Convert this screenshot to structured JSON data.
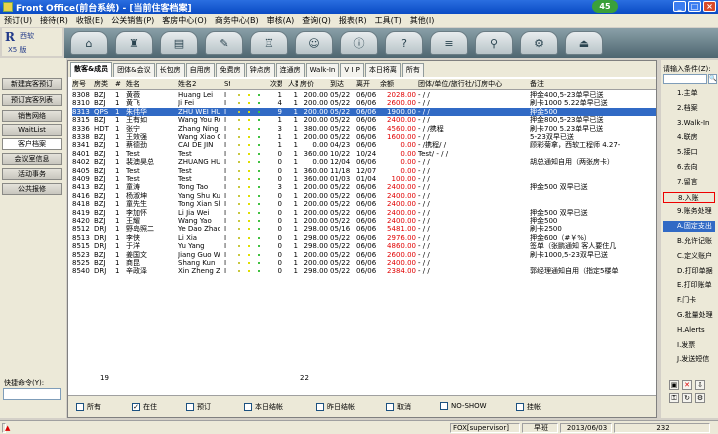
{
  "window": {
    "title": "Front Office(前台系统) - [当前住客档案]",
    "notification_count": "45"
  },
  "menu": [
    "预订(U)",
    "接待(R)",
    "收银(E)",
    "公关销售(P)",
    "客房中心(O)",
    "商务中心(B)",
    "审核(A)",
    "查询(Q)",
    "报表(R)",
    "工具(T)",
    "其他(I)"
  ],
  "logo": {
    "mark": "R",
    "brand": "西软",
    "version": "X5 版"
  },
  "left_nav": [
    "新建宾客预订",
    "预订宾客列表",
    "销售网络",
    "WaitList",
    "客户档案",
    "会议室信息",
    "活动事务",
    "公共报修"
  ],
  "shortcut_label": "快捷命令(Y):",
  "tabs": [
    "散客&成员",
    "团体&会议",
    "长包房",
    "自用房",
    "免费房",
    "钟点房",
    "连通房",
    "Walk-In",
    "V I P",
    "本日将离",
    "所有"
  ],
  "table": {
    "headers": [
      "房号",
      "房类",
      "#",
      "姓名",
      "姓名2",
      "Sta",
      "",
      "次数",
      "人数",
      "房价",
      "到达",
      "离开",
      "余额",
      "团体/单位/旅行社/订房中心",
      "备注"
    ],
    "rows": [
      [
        "8308",
        "BZJ",
        "1",
        "黄薇",
        "Huang Lei",
        "I",
        "1",
        "1",
        "200.00",
        "05/22",
        "06/06",
        "2028.00",
        "- / /",
        "押金400,5-23单早已送"
      ],
      [
        "8310",
        "BZJ",
        "1",
        "黄飞",
        "Ji Fei",
        "I",
        "4",
        "1",
        "200.00",
        "05/22",
        "06/06",
        "2600.00",
        "- / /",
        "刷卡1000  5.22单早已送"
      ],
      [
        "8313",
        "QPS",
        "1",
        "朱伟华",
        "ZHU WEI HUA",
        "I",
        "9",
        "1",
        "200.00",
        "05/22",
        "06/06",
        "1900.00",
        "- / /",
        "押金500"
      ],
      [
        "8315",
        "BZJ",
        "1",
        "王有如",
        "Wang You Ru",
        "I",
        "1",
        "1",
        "200.00",
        "05/22",
        "06/06",
        "2400.00",
        "- / /",
        "押金800,5-23单早已送"
      ],
      [
        "8336",
        "HDT",
        "1",
        "张宁",
        "Zhang Ning",
        "I",
        "3",
        "1",
        "380.00",
        "05/22",
        "06/06",
        "4560.00",
        "- / /携程",
        "刷卡700  5.23单早已送"
      ],
      [
        "8338",
        "BZJ",
        "1",
        "王效强",
        "Wang Xiao Q",
        "I",
        "1",
        "1",
        "200.00",
        "05/22",
        "06/06",
        "1600.00",
        "- / /",
        "5-23双早已送"
      ],
      [
        "8341",
        "BZJ",
        "1",
        "蔡德劲",
        "CAI DE JIN",
        "I",
        "1",
        "1",
        "0.00",
        "04/23",
        "06/06",
        "0.00",
        "- /携程/ /",
        "顾彩菊拿，西软工程师 4.27-"
      ],
      [
        "8401",
        "BZJ",
        "1",
        "Test",
        "Test",
        "I",
        "0",
        "1",
        "360.00",
        "10/22",
        "10/24",
        "0.00",
        "Test/ - / /",
        ""
      ],
      [
        "8402",
        "BZJ",
        "1",
        "裴澳昊总",
        "ZHUANG HUAN",
        "I",
        "0",
        "1",
        "0.00",
        "12/04",
        "06/06",
        "0.00",
        "- / /",
        "胡总通知自用（两张房卡）"
      ],
      [
        "8405",
        "BZJ",
        "1",
        "Test",
        "Test",
        "I",
        "0",
        "1",
        "360.00",
        "11/18",
        "12/07",
        "0.00",
        "- / /",
        ""
      ],
      [
        "8409",
        "BZJ",
        "1",
        "Test",
        "Test",
        "I",
        "0",
        "1",
        "360.00",
        "01/03",
        "01/04",
        "100.00",
        "- / /",
        ""
      ],
      [
        "8413",
        "BZJ",
        "1",
        "童涛",
        "Tong Tao",
        "I",
        "3",
        "1",
        "200.00",
        "05/22",
        "06/06",
        "2400.00",
        "- / /",
        "押金500 双早已送"
      ],
      [
        "8416",
        "BZJ",
        "1",
        "杨淑坤",
        "Yang Shu Kun",
        "I",
        "0",
        "1",
        "200.00",
        "05/22",
        "06/06",
        "2400.00",
        "- / /",
        ""
      ],
      [
        "8418",
        "BZJ",
        "1",
        "童先生",
        "Tong Xian Sh",
        "I",
        "0",
        "1",
        "200.00",
        "05/22",
        "06/06",
        "2400.00",
        "- / /",
        ""
      ],
      [
        "8419",
        "BZJ",
        "1",
        "李加怀",
        "Li Jia Wei",
        "I",
        "0",
        "1",
        "200.00",
        "05/22",
        "06/06",
        "2400.00",
        "- / /",
        "押金500  双早已送"
      ],
      [
        "8420",
        "BZJ",
        "1",
        "王耀",
        "Wang Yao",
        "I",
        "0",
        "1",
        "200.00",
        "05/22",
        "06/06",
        "2400.00",
        "- / /",
        "押金500"
      ],
      [
        "8512",
        "DRJ",
        "1",
        "野岛照二",
        "Ye Dao Zhao E",
        "I",
        "0",
        "1",
        "298.00",
        "05/16",
        "06/06",
        "5481.00",
        "- / /",
        "刷卡2500"
      ],
      [
        "8513",
        "DRJ",
        "1",
        "李侠",
        "Li Xia",
        "I",
        "0",
        "1",
        "298.00",
        "05/22",
        "06/06",
        "2976.00",
        "- / /",
        "押金600（#￥%）"
      ],
      [
        "8515",
        "DRJ",
        "1",
        "于洋",
        "Yu Yang",
        "I",
        "0",
        "1",
        "298.00",
        "05/22",
        "06/06",
        "4860.00",
        "- / /",
        "签单（张鹏通知 客人要住几"
      ],
      [
        "8523",
        "BZJ",
        "1",
        "姜国文",
        "Jiang Guo Wen",
        "I",
        "0",
        "1",
        "200.00",
        "05/22",
        "06/06",
        "2600.00",
        "- / /",
        "刷卡1000,5-23双早已送"
      ],
      [
        "8525",
        "BZJ",
        "1",
        "商昆",
        "Shang Kun",
        "I",
        "0",
        "1",
        "200.00",
        "05/22",
        "06/06",
        "2400.00",
        "- / /",
        ""
      ],
      [
        "8540",
        "DRJ",
        "1",
        "辛政泽",
        "Xin Zheng Ze",
        "I",
        "0",
        "1",
        "298.00",
        "05/22",
        "06/06",
        "2384.00",
        "- / /",
        "郭经理通知自用（指定5楼单"
      ]
    ],
    "selected_row": 2,
    "total_rooms": "19",
    "total_persons": "22"
  },
  "filters": [
    {
      "label": "所有",
      "checked": false
    },
    {
      "label": "在住",
      "checked": true
    },
    {
      "label": "预订",
      "checked": false
    },
    {
      "label": "本日结帐",
      "checked": false
    },
    {
      "label": "昨日结帐",
      "checked": false
    },
    {
      "label": "取消",
      "checked": false
    },
    {
      "label": "NO-SHOW",
      "checked": false
    },
    {
      "label": "挂帐",
      "checked": false
    }
  ],
  "right_panel": {
    "title": "请输入条件(Z):",
    "items": [
      "1.主单",
      "2.档案",
      "3.Walk-In",
      "4.联房",
      "5.接口",
      "6.去向",
      "7.留言",
      "8.入账",
      "9.账务处理",
      "A.固定支出",
      "B.允许记账",
      "C.定义账户",
      "D.打印单据",
      "E.打印账单",
      "F.门卡",
      "G.批量处理",
      "H.Alerts",
      "I.发票",
      "J.发送短信"
    ]
  },
  "status": {
    "user": "FOX[supervisor]",
    "shift": "早班",
    "date": "2013/06/03",
    "count": "232"
  }
}
